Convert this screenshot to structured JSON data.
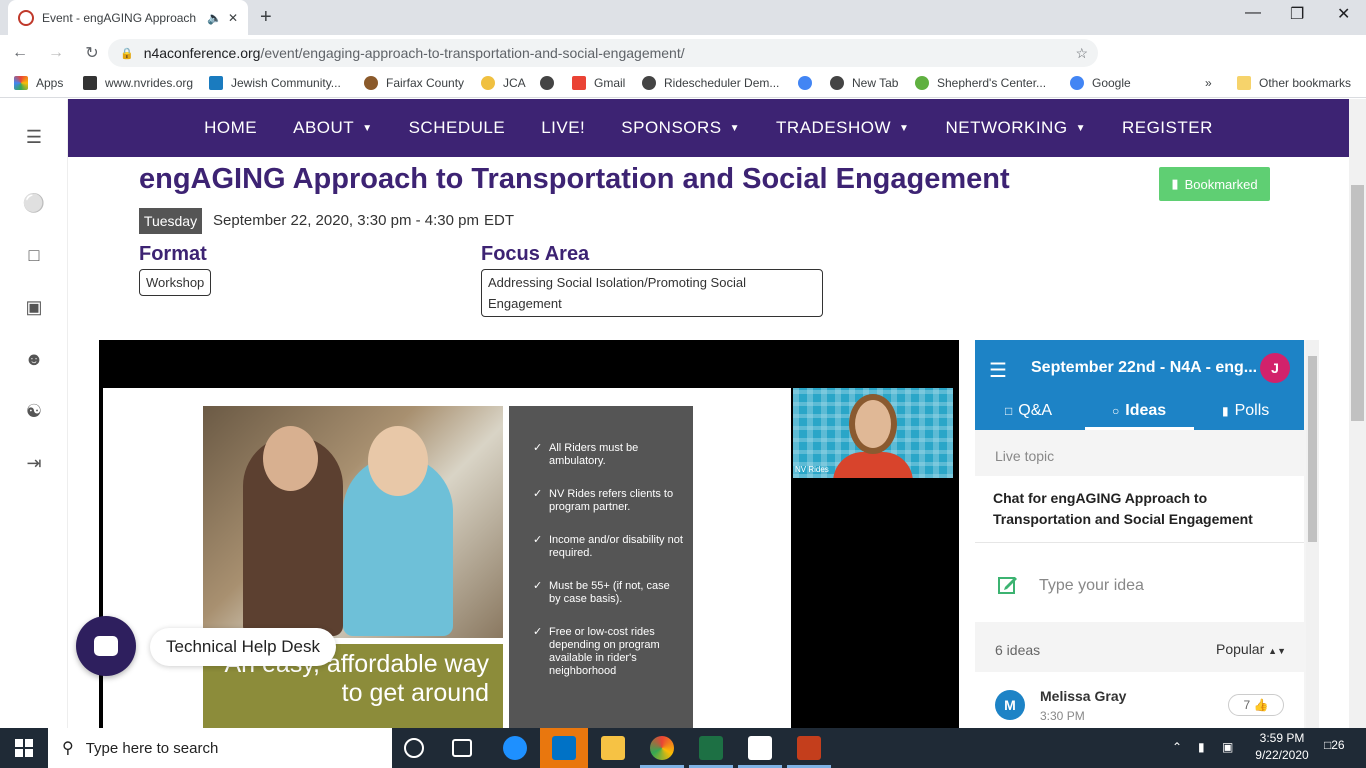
{
  "browser": {
    "tab_title": "Event - engAGING Approach",
    "url_host": "n4aconference.org",
    "url_path": "/event/engaging-approach-to-transportation-and-social-engagement/"
  },
  "bookmarks": [
    "Apps",
    "www.nvrides.org",
    "Jewish Community...",
    "Fairfax County",
    "JCA",
    "Gmail",
    "Ridescheduler Dem...",
    "New Tab",
    "Shepherd's Center...",
    "Google",
    "Other bookmarks"
  ],
  "nav": [
    "HOME",
    "ABOUT",
    "SCHEDULE",
    "LIVE!",
    "SPONSORS",
    "TRADESHOW",
    "NETWORKING",
    "REGISTER"
  ],
  "event": {
    "title": "engAGING Approach to Transportation and Social Engagement",
    "bookmark_label": "Bookmarked",
    "day": "Tuesday",
    "date": "September 22, 2020, 3:30 pm - 4:30 pm",
    "timezone": "EDT",
    "format_label": "Format",
    "format_value": "Workshop",
    "focus_label": "Focus Area",
    "focus_value": "Addressing Social Isolation/Promoting Social Engagement"
  },
  "slide": {
    "caption_line1": "An easy, affordable way",
    "caption_line2": "to get around",
    "bullets": [
      "All Riders must be ambulatory.",
      "NV Rides refers clients to program partner.",
      "Income and/or disability not required.",
      "Must be 55+ (if not, case by case basis).",
      "Free or low-cost rides depending on program available in rider's neighborhood"
    ],
    "webcam_label": "NV Rides"
  },
  "help_desk": "Technical Help Desk",
  "slido": {
    "title": "September 22nd - N4A - eng...",
    "avatar": "J",
    "tabs": [
      "Q&A",
      "Ideas",
      "Polls"
    ],
    "live_topic": "Live topic",
    "topic": "Chat for engAGING Approach to Transportation and Social Engagement",
    "placeholder": "Type your idea",
    "ideas_count": "6 ideas",
    "sort": "Popular",
    "idea_author": "Melissa Gray",
    "idea_author_initial": "M",
    "idea_time": "3:30 PM",
    "idea_likes": "7"
  },
  "taskbar": {
    "search": "Type here to search",
    "time": "3:59 PM",
    "date": "9/22/2020",
    "notifications": "26"
  }
}
